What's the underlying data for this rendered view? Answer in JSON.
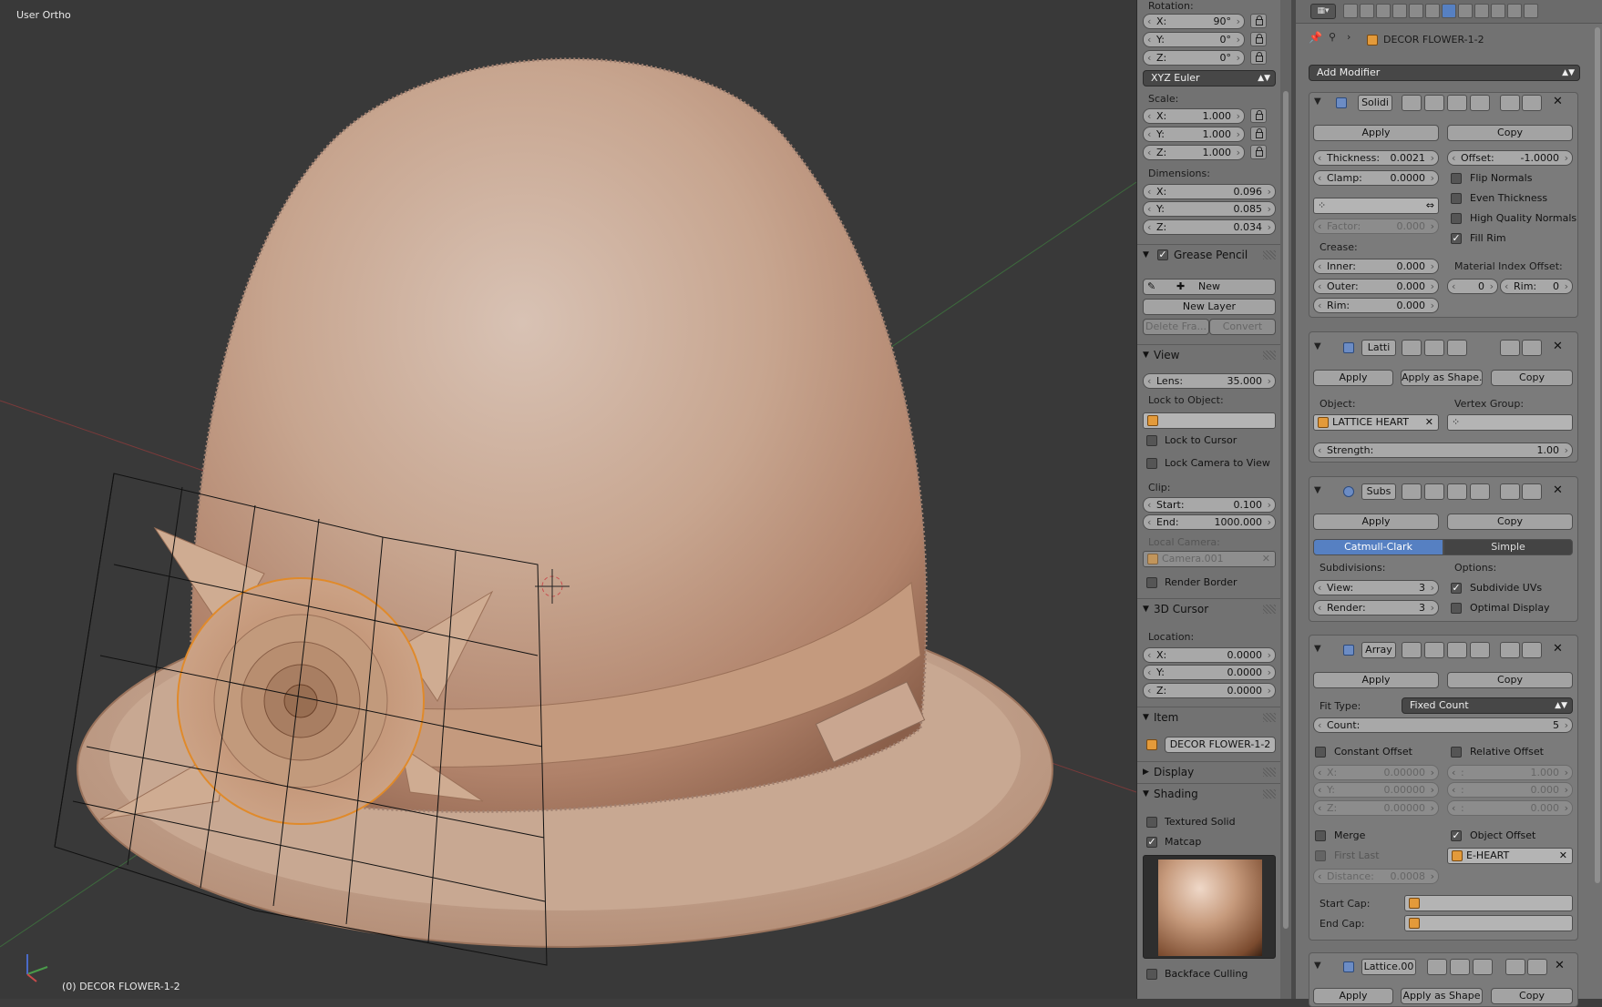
{
  "viewport": {
    "view_name": "User Ortho",
    "object_info": "(0) DECOR FLOWER-1-2"
  },
  "npanel": {
    "rotation_label": "Rotation:",
    "rotation": [
      {
        "k": "X:",
        "v": "90°"
      },
      {
        "k": "Y:",
        "v": "0°"
      },
      {
        "k": "Z:",
        "v": "0°"
      }
    ],
    "rotation_mode": "XYZ Euler",
    "scale_label": "Scale:",
    "scale": [
      {
        "k": "X:",
        "v": "1.000"
      },
      {
        "k": "Y:",
        "v": "1.000"
      },
      {
        "k": "Z:",
        "v": "1.000"
      }
    ],
    "dimensions_label": "Dimensions:",
    "dimensions": [
      {
        "k": "X:",
        "v": "0.096"
      },
      {
        "k": "Y:",
        "v": "0.085"
      },
      {
        "k": "Z:",
        "v": "0.034"
      }
    ],
    "grease_pencil": {
      "title": "Grease Pencil",
      "checked": true,
      "new": "New",
      "new_layer": "New Layer",
      "delete_frame": "Delete Fra...",
      "convert": "Convert"
    },
    "view": {
      "title": "View",
      "lens": {
        "k": "Lens:",
        "v": "35.000"
      },
      "lock_to_object": "Lock to Object:",
      "lock_to_cursor": "Lock to Cursor",
      "lock_camera": "Lock Camera to View",
      "clip": "Clip:",
      "start": {
        "k": "Start:",
        "v": "0.100"
      },
      "end": {
        "k": "End:",
        "v": "1000.000"
      },
      "local_camera": "Local Camera:",
      "camera": "Camera.001",
      "render_border": "Render Border"
    },
    "cursor": {
      "title": "3D Cursor",
      "location": "Location:",
      "values": [
        {
          "k": "X:",
          "v": "0.0000"
        },
        {
          "k": "Y:",
          "v": "0.0000"
        },
        {
          "k": "Z:",
          "v": "0.0000"
        }
      ]
    },
    "item": {
      "title": "Item",
      "name": "DECOR FLOWER-1-2"
    },
    "display": {
      "title": "Display"
    },
    "shading": {
      "title": "Shading",
      "textured_solid": "Textured Solid",
      "matcap": "Matcap",
      "matcap_checked": true,
      "backface_culling": "Backface Culling"
    }
  },
  "props": {
    "object_name": "DECOR FLOWER-1-2",
    "add_modifier": "Add Modifier",
    "solidify": {
      "name": "Solidi",
      "apply": "Apply",
      "copy": "Copy",
      "thickness": {
        "k": "Thickness:",
        "v": "0.0021"
      },
      "offset": {
        "k": "Offset:",
        "v": "-1.0000"
      },
      "clamp": {
        "k": "Clamp:",
        "v": "0.0000"
      },
      "factor": {
        "k": "Factor:",
        "v": "0.000"
      },
      "flip_normals": "Flip Normals",
      "even_thickness": "Even Thickness",
      "hq_normals": "High Quality Normals",
      "fill_rim": "Fill Rim",
      "fill_rim_checked": true,
      "crease": "Crease:",
      "inner": {
        "k": "Inner:",
        "v": "0.000"
      },
      "outer": {
        "k": "Outer:",
        "v": "0.000"
      },
      "rim": {
        "k": "Rim:",
        "v": "0.000"
      },
      "mat_index": "Material Index Offset:",
      "mat_idx_val": "0",
      "rim_k": "Rim:",
      "rim_v": "0"
    },
    "lattice": {
      "name": "Latti",
      "apply": "Apply",
      "apply_shape": "Apply as Shape...",
      "copy": "Copy",
      "object_label": "Object:",
      "vertex_group": "Vertex Group:",
      "object": "LATTICE HEART",
      "strength": {
        "k": "Strength:",
        "v": "1.00"
      }
    },
    "subsurf": {
      "name": "Subs",
      "apply": "Apply",
      "copy": "Copy",
      "catmull": "Catmull-Clark",
      "simple": "Simple",
      "subdivisions": "Subdivisions:",
      "options": "Options:",
      "view": {
        "k": "View:",
        "v": "3"
      },
      "render": {
        "k": "Render:",
        "v": "3"
      },
      "subdivide_uvs": "Subdivide UVs",
      "subdivide_uvs_checked": true,
      "optimal_display": "Optimal Display"
    },
    "array": {
      "name": "Array",
      "apply": "Apply",
      "copy": "Copy",
      "fit_type_label": "Fit Type:",
      "fit_type": "Fixed Count",
      "count": {
        "k": "Count:",
        "v": "5"
      },
      "constant_offset": "Constant Offset",
      "relative_offset": "Relative Offset",
      "const": [
        {
          "k": "X:",
          "v": "0.00000"
        },
        {
          "k": "Y:",
          "v": "0.00000"
        },
        {
          "k": "Z:",
          "v": "0.00000"
        }
      ],
      "rel": [
        {
          "k": ":",
          "v": "1.000"
        },
        {
          "k": ":",
          "v": "0.000"
        },
        {
          "k": ":",
          "v": "0.000"
        }
      ],
      "merge": "Merge",
      "first_last": "First Last",
      "object_offset": "Object Offset",
      "object_offset_checked": true,
      "offset_object": "E-HEART",
      "distance": {
        "k": "Distance:",
        "v": "0.0008"
      },
      "start_cap": "Start Cap:",
      "end_cap": "End Cap:"
    },
    "lattice2": {
      "name": "Lattice.00",
      "apply": "Apply",
      "apply_shape": "Apply as Shape",
      "copy": "Copy"
    }
  },
  "colors": {
    "accent": "#5680c2",
    "hat": "#c9a88e",
    "viewport_bg": "#393939"
  }
}
